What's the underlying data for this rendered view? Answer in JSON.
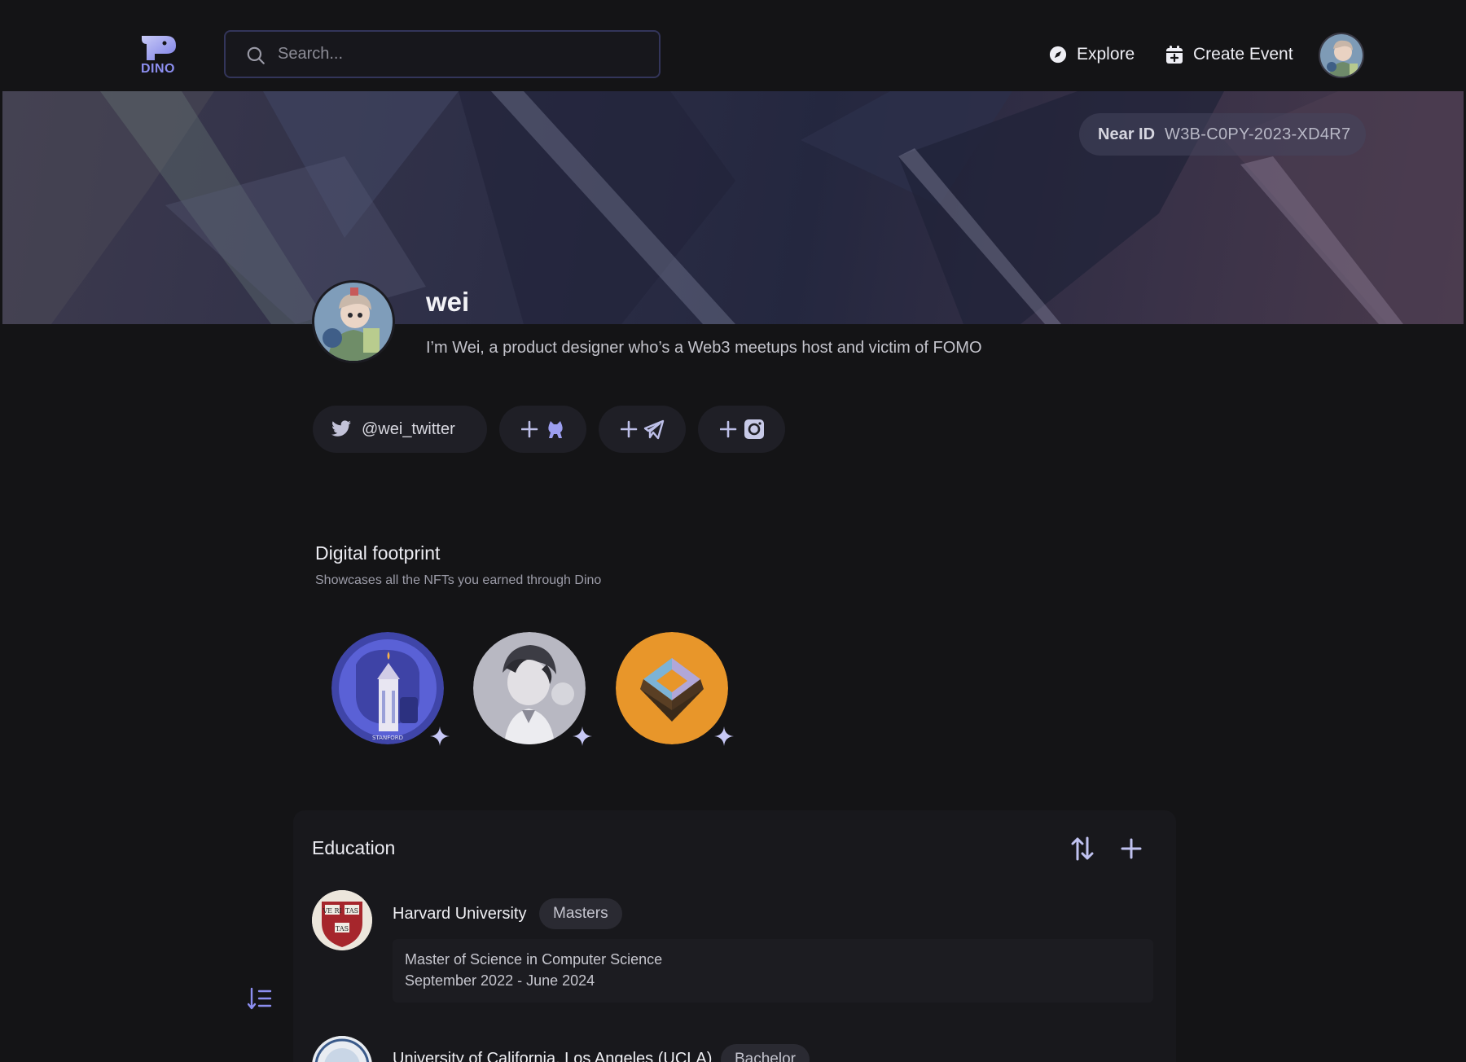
{
  "nav": {
    "logo_text": "DINO",
    "search_placeholder": "Search...",
    "explore_label": "Explore",
    "create_event_label": "Create Event"
  },
  "banner": {
    "near_id_label": "Near ID",
    "near_id_value": "W3B-C0PY-2023-XD4R7"
  },
  "profile": {
    "name": "wei",
    "bio": "I’m Wei, a product designer who’s a Web3 meetups host and victim of FOMO"
  },
  "socials": {
    "twitter_handle": "@wei_twitter",
    "add_github_icon": "github-cat-icon",
    "add_telegram_icon": "telegram-icon",
    "add_instagram_icon": "instagram-icon"
  },
  "digital_footprint": {
    "title": "Digital footprint",
    "subtitle": "Showcases all the NFTs you earned through Dino",
    "nfts": [
      "stanford-event-nft",
      "anime-portrait-nft",
      "orange-layers-nft"
    ]
  },
  "education": {
    "title": "Education",
    "items": [
      {
        "school": "Harvard University",
        "degree": "Masters",
        "program": "Master of Science in Computer Science",
        "dates": "September 2022 - June 2024"
      },
      {
        "school": "University of California, Los Angeles (UCLA)",
        "degree": "Bachelor"
      }
    ]
  },
  "colors": {
    "background": "#141416",
    "accent": "#8c8ef0",
    "pill": "#1f1f26"
  }
}
